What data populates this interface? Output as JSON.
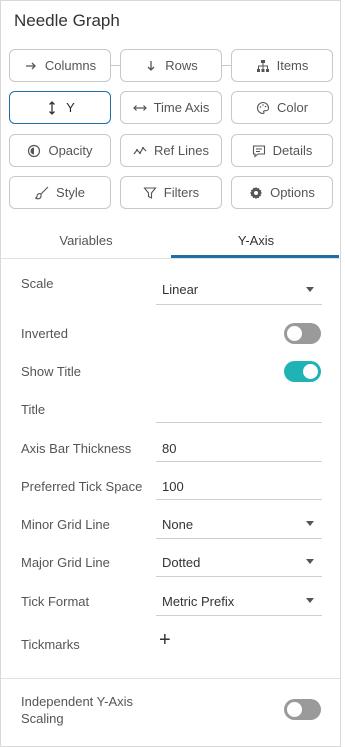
{
  "panel": {
    "title": "Needle Graph"
  },
  "fields": {
    "columns": "Columns",
    "rows": "Rows",
    "items": "Items",
    "y": "Y",
    "time_axis": "Time Axis",
    "color": "Color",
    "opacity": "Opacity",
    "ref_lines": "Ref Lines",
    "details": "Details",
    "style": "Style",
    "filters": "Filters",
    "options": "Options"
  },
  "tabs": {
    "variables": "Variables",
    "y_axis": "Y-Axis",
    "active": "Y-Axis"
  },
  "settings": {
    "scale": {
      "label": "Scale",
      "value": "Linear"
    },
    "inverted": {
      "label": "Inverted",
      "on": false
    },
    "show_title": {
      "label": "Show Title",
      "on": true
    },
    "title": {
      "label": "Title",
      "value": ""
    },
    "axis_bar_thickness": {
      "label": "Axis Bar Thickness",
      "value": "80"
    },
    "preferred_tick_space": {
      "label": "Preferred Tick Space",
      "value": "100"
    },
    "minor_grid_line": {
      "label": "Minor Grid Line",
      "value": "None"
    },
    "major_grid_line": {
      "label": "Major Grid Line",
      "value": "Dotted"
    },
    "tick_format": {
      "label": "Tick Format",
      "value": "Metric Prefix"
    },
    "tickmarks": {
      "label": "Tickmarks",
      "add": "+"
    },
    "independent_scaling": {
      "label_line1": "Independent Y-Axis",
      "label_line2": "Scaling",
      "on": false
    }
  },
  "colors": {
    "accent": "#1f6ea8",
    "toggle_on": "#1fb3b6",
    "toggle_off": "#9a9a9a"
  },
  "icons": {
    "columns": "arrow-right-icon",
    "rows": "arrow-down-icon",
    "items": "hierarchy-icon",
    "y": "vertical-arrows-icon",
    "time_axis": "horizontal-arrows-icon",
    "color": "palette-icon",
    "opacity": "opacity-icon",
    "ref_lines": "ref-lines-icon",
    "details": "chat-icon",
    "style": "brush-icon",
    "filters": "filter-icon",
    "options": "gear-icon"
  }
}
